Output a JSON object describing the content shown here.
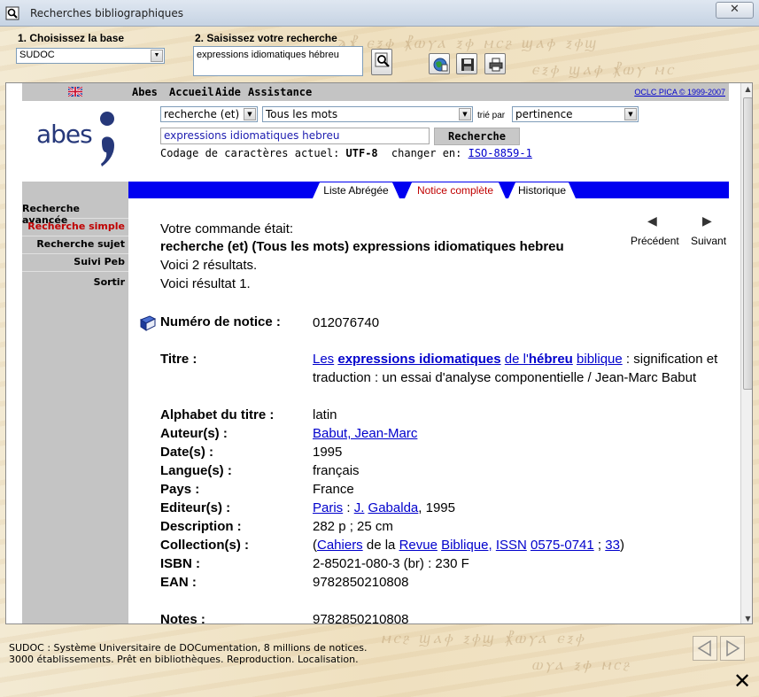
{
  "window": {
    "title": "Recherches bibliographiques",
    "close_label": "✕"
  },
  "toolbar": {
    "step1_label": "1. Choisissez la base",
    "base_value": "SUDOC",
    "step2_label": "2. Saisissez votre recherche",
    "search_value": "expressions idiomatiques hébreu"
  },
  "menu": {
    "items": [
      "Abes",
      "Accueil",
      "Aide",
      "Assistance"
    ],
    "copyright": "OCLC PICA © 1999-2007"
  },
  "logo": {
    "text": "abes"
  },
  "search_form": {
    "operator": "recherche (et)",
    "scope": "Tous les mots",
    "sort_label": "trié par",
    "sort_value": "pertinence",
    "terms": "expressions idiomatiques hebreu",
    "button": "Recherche",
    "encoding_label": "Codage de caractères actuel:",
    "encoding_value": "UTF-8",
    "change_label": "changer en:",
    "change_link": "ISO-8859-1"
  },
  "tabs": [
    {
      "label": "Liste Abrégée",
      "active": false
    },
    {
      "label": "Notice complète",
      "active": true
    },
    {
      "label": "Historique",
      "active": false
    }
  ],
  "sidebar": {
    "items": [
      {
        "label": "Recherche avancée",
        "color": "#000000"
      },
      {
        "label": "Recherche simple",
        "color": "#c00000"
      },
      {
        "label": "Recherche sujet",
        "color": "#000000"
      },
      {
        "label": "Suivi Peb",
        "color": "#000000"
      },
      {
        "label": "Sortir",
        "color": "#000000"
      }
    ]
  },
  "result": {
    "command_label": "Votre commande était:",
    "command": "recherche (et) (Tous les mots) expressions idiomatiques hebreu",
    "count": "Voici 2 résultats.",
    "current": "Voici résultat 1.",
    "prev": "Précédent",
    "next": "Suivant"
  },
  "record": {
    "notice_label": "Numéro de notice :",
    "notice_value": "012076740",
    "titre_label": "Titre :",
    "titre_link_1": "Les",
    "titre_link_2": "expressions idiomatiques",
    "titre_link_3": "de l'",
    "titre_link_4": "hébreu",
    "titre_link_5": "biblique",
    "titre_rest": " : signification et traduction : un essai d'analyse componentielle / Jean-Marc Babut",
    "alphabet_label": "Alphabet du titre :",
    "alphabet_value": "latin",
    "auteur_label": "Auteur(s) :",
    "auteur_value": "Babut, Jean-Marc",
    "date_label": "Date(s) :",
    "date_value": "1995",
    "langue_label": "Langue(s) :",
    "langue_value": "français",
    "pays_label": "Pays :",
    "pays_value": "France",
    "editeur_label": "Editeur(s) :",
    "editeur_place": "Paris",
    "editeur_sep": " : ",
    "editeur_j": "J.",
    "editeur_name": "Gabalda",
    "editeur_year": ", 1995",
    "description_label": "Description :",
    "description_value": "282 p ; 25 cm",
    "collection_label": "Collection(s) :",
    "collection_open": "(",
    "collection_l1": "Cahiers",
    "collection_t1": " de la ",
    "collection_l2": "Revue",
    "collection_l3": "Biblique,",
    "collection_l4": "ISSN",
    "collection_l5": "0575-0741",
    "collection_t2": " ; ",
    "collection_l6": "33",
    "collection_close": ")",
    "isbn_label": "ISBN :",
    "isbn_value": "2-85021-080-3 (br) : 230 F",
    "ean_label": "EAN :",
    "ean_value": "9782850210808",
    "notes_label": "Notes :",
    "notes_value": "9782850210808"
  },
  "footer": {
    "line1": "SUDOC : Système Universitaire de DOCumentation, 8 millions de notices.",
    "line2": "3000 établissements. Prêt en bibliothèques. Reproduction. Localisation."
  }
}
